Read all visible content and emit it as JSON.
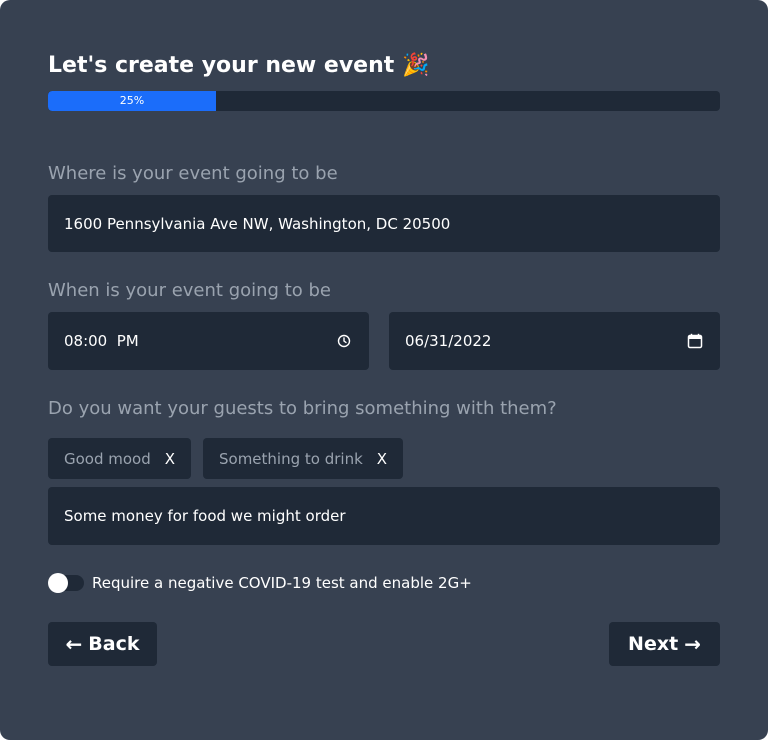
{
  "header": {
    "title": "Let's create your new event",
    "title_emoji": "🎉"
  },
  "progress": {
    "value": 0.25,
    "label": "25%",
    "color": "#1b6dfa"
  },
  "location": {
    "label": "Where is your event going to be",
    "value": "1600 Pennsylvania Ave NW, Washington, DC 20500"
  },
  "when": {
    "label": "When is your event going to be",
    "time_value": "08:00  PM",
    "time_icon": "clock-icon",
    "date_value": "06/31/2022",
    "date_icon": "calendar-icon"
  },
  "bring": {
    "label": "Do you want your guests to bring something with them?",
    "tags": [
      {
        "label": "Good mood",
        "remove": "X"
      },
      {
        "label": "Something to drink",
        "remove": "X"
      }
    ],
    "input_value": "Some money for food we might order"
  },
  "covid": {
    "label": "Require a negative COVID-19 test and enable 2G+",
    "enabled": false
  },
  "actions": {
    "back_arrow": "←",
    "back_label": "Back",
    "next_label": "Next",
    "next_arrow": "→"
  },
  "colors": {
    "card": "#374151",
    "field": "#1f2937",
    "muted_text": "#9aa3af",
    "accent": "#1b6dfa"
  }
}
